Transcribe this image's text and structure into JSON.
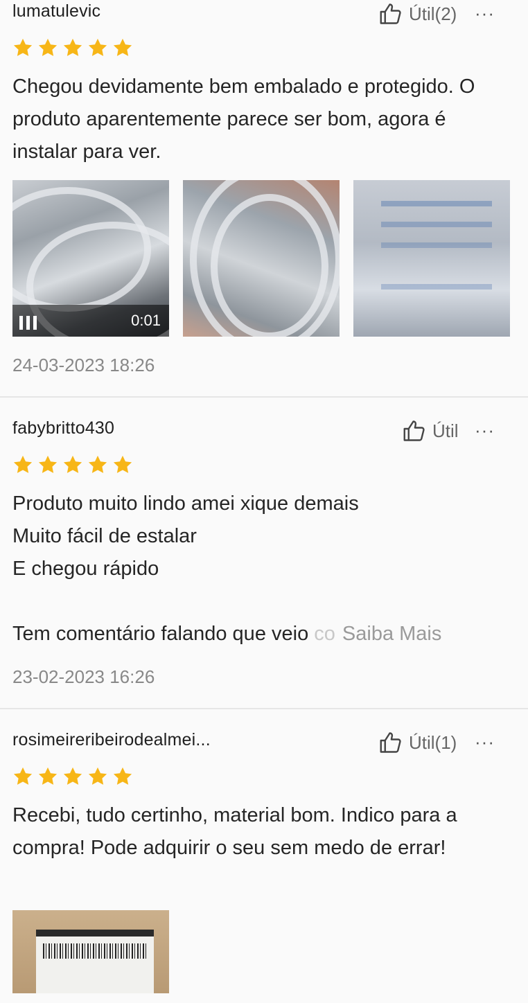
{
  "reviews": [
    {
      "username": "lumatulevic",
      "useful_label": "Útil(2)",
      "more_label": "···",
      "rating": 5,
      "text": "Chegou devidamente bem embalado e protegido. O produto aparentemente parece ser bom, agora é instalar para ver.",
      "video_duration": "0:01",
      "date": "24-03-2023 18:26"
    },
    {
      "username": "fabybritto430",
      "useful_label": "Útil",
      "more_label": "···",
      "rating": 5,
      "text": "Produto muito lindo amei xique demais\nMuito fácil de estalar\nE chegou rápido\n\nTem comentário falando que veio ",
      "text_fade": "co",
      "read_more": "Saiba Mais",
      "date": "23-02-2023 16:26"
    },
    {
      "username": "rosimeireribeirodealmei...",
      "useful_label": "Útil(1)",
      "more_label": "···",
      "rating": 5,
      "text": "Recebi, tudo certinho, material bom. Indico para a compra! Pode adquirir o seu sem medo de errar!"
    }
  ],
  "colors": {
    "star": "#f7b617",
    "divider": "#e6e6e6",
    "date": "#888888"
  }
}
